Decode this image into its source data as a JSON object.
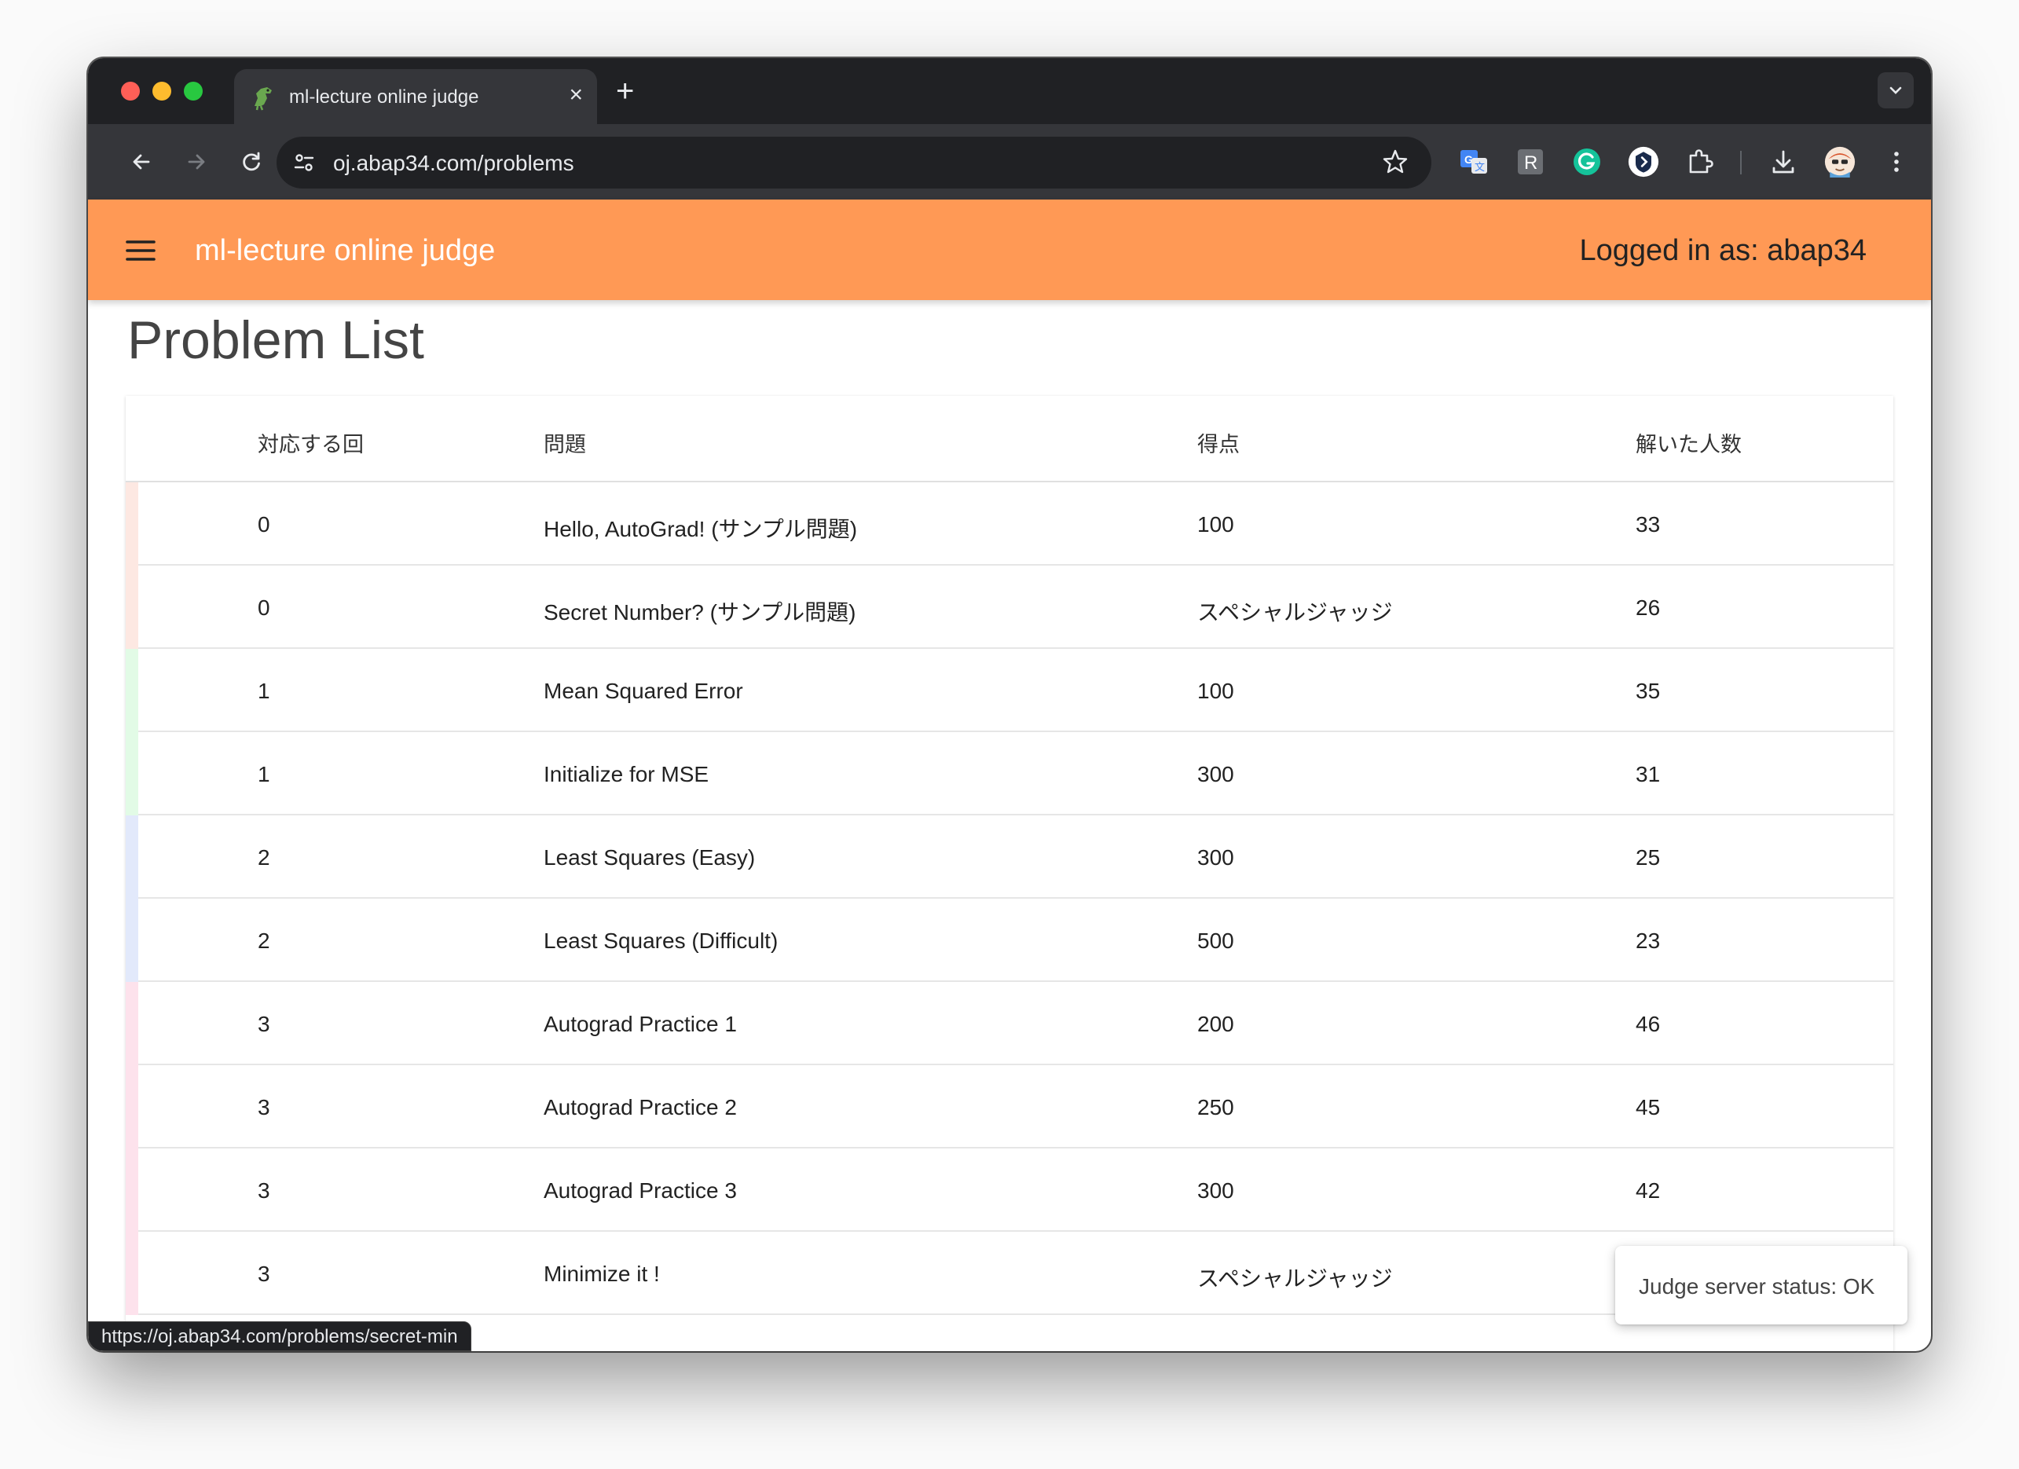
{
  "browser": {
    "tab_title": "ml-lecture online judge",
    "url": "oj.abap34.com/problems",
    "status_url": "https://oj.abap34.com/problems/secret-min",
    "favicon_icon": "dinosaur-icon",
    "extensions": [
      "translate-icon",
      "r-extension-icon",
      "grammarly-icon",
      "shield-extension-icon",
      "puzzle-extensions-icon"
    ],
    "accent": "#ff9955"
  },
  "app": {
    "title": "ml-lecture online judge",
    "login_label": "Logged in as: abap34"
  },
  "page": {
    "title": "Problem List"
  },
  "table": {
    "headers": [
      "対応する回",
      "問題",
      "得点",
      "解いた人数"
    ],
    "rows": [
      {
        "round": "0",
        "problem": "Hello, AutoGrad! (サンプル問題)",
        "score": "100",
        "solved": "33",
        "stripe": "#fde8e2"
      },
      {
        "round": "0",
        "problem": "Secret Number? (サンプル問題)",
        "score": "スペシャルジャッジ",
        "solved": "26",
        "stripe": "#fde8e2"
      },
      {
        "round": "1",
        "problem": "Mean Squared Error",
        "score": "100",
        "solved": "35",
        "stripe": "#e2fbe6"
      },
      {
        "round": "1",
        "problem": "Initialize for MSE",
        "score": "300",
        "solved": "31",
        "stripe": "#e2fbe6"
      },
      {
        "round": "2",
        "problem": "Least Squares (Easy)",
        "score": "300",
        "solved": "25",
        "stripe": "#e2e9fb"
      },
      {
        "round": "2",
        "problem": "Least Squares (Difficult)",
        "score": "500",
        "solved": "23",
        "stripe": "#e2e9fb"
      },
      {
        "round": "3",
        "problem": "Autograd Practice 1",
        "score": "200",
        "solved": "46",
        "stripe": "#fde2ec"
      },
      {
        "round": "3",
        "problem": "Autograd Practice 2",
        "score": "250",
        "solved": "45",
        "stripe": "#fde2ec"
      },
      {
        "round": "3",
        "problem": "Autograd Practice 3",
        "score": "300",
        "solved": "42",
        "stripe": "#fde2ec"
      },
      {
        "round": "3",
        "problem": "Minimize it !",
        "score": "スペシャルジャッジ",
        "solved": "",
        "stripe": "#fde2ec"
      }
    ]
  },
  "toast": {
    "text": "Judge server status: OK"
  }
}
